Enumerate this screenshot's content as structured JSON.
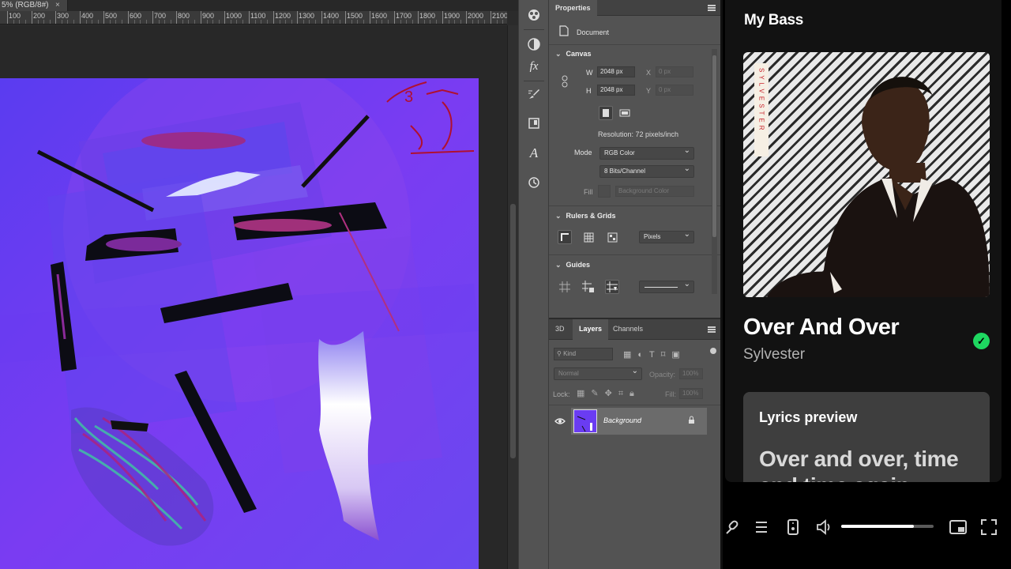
{
  "photoshop": {
    "doc_tab_title": "5% (RGB/8#)",
    "doc_tab_close": "×",
    "ruler_labels": [
      "100",
      "200",
      "300",
      "400",
      "500",
      "600",
      "700",
      "800",
      "900",
      "1000",
      "1100",
      "1200",
      "1300",
      "1400",
      "1500",
      "1600",
      "1700",
      "1800",
      "1900",
      "2000",
      "2100"
    ],
    "canvas_scribble": "3",
    "properties": {
      "tab": "Properties",
      "document_label": "Document",
      "canvas_section": "Canvas",
      "w_label": "W",
      "w_value": "2048 px",
      "h_label": "H",
      "h_value": "2048 px",
      "x_label": "X",
      "x_value": "0 px",
      "y_label": "Y",
      "y_value": "0 px",
      "resolution": "Resolution: 72 pixels/inch",
      "mode_label": "Mode",
      "mode_value": "RGB Color",
      "bits_value": "8 Bits/Channel",
      "fill_label": "Fill",
      "fill_value": "Background Color",
      "rulers_section": "Rulers & Grids",
      "units_value": "Pixels",
      "guides_section": "Guides"
    },
    "layers": {
      "tab_3d": "3D",
      "tab_layers": "Layers",
      "tab_channels": "Channels",
      "filter_kind": "Kind",
      "blend_mode": "Normal",
      "opacity_label": "Opacity:",
      "opacity_value": "100%",
      "lock_label": "Lock:",
      "fill_label": "Fill:",
      "fill_value": "100%",
      "layer_name": "Background"
    },
    "colors": {
      "artwork": "#6a3cf2",
      "panel": "#535353"
    }
  },
  "spotify": {
    "title": "My Bass",
    "cover_text": "SYLVESTER",
    "track": "Over And Over",
    "artist": "Sylvester",
    "saved_check": "✓",
    "lyrics_title": "Lyrics preview",
    "lyrics_line": "Over and over, time and time again",
    "volume_level": 0.79,
    "colors": {
      "accent": "#1ed760",
      "background": "#121212",
      "lyrics_card": "#3e3e3e"
    }
  },
  "icons": [
    "close-icon",
    "color-icon",
    "adjustments-icon",
    "fx-icon",
    "brush-icon",
    "library-icon",
    "character-icon",
    "history-icon",
    "document-icon",
    "link-icon",
    "portrait-icon",
    "landscape-icon",
    "ruler-icon",
    "grid-icon",
    "pixel-grid-icon",
    "guide-icon",
    "eye-icon",
    "lock-icon",
    "microphone-icon",
    "queue-icon",
    "connect-device-icon",
    "volume-icon",
    "miniplayer-icon",
    "fullscreen-icon"
  ]
}
